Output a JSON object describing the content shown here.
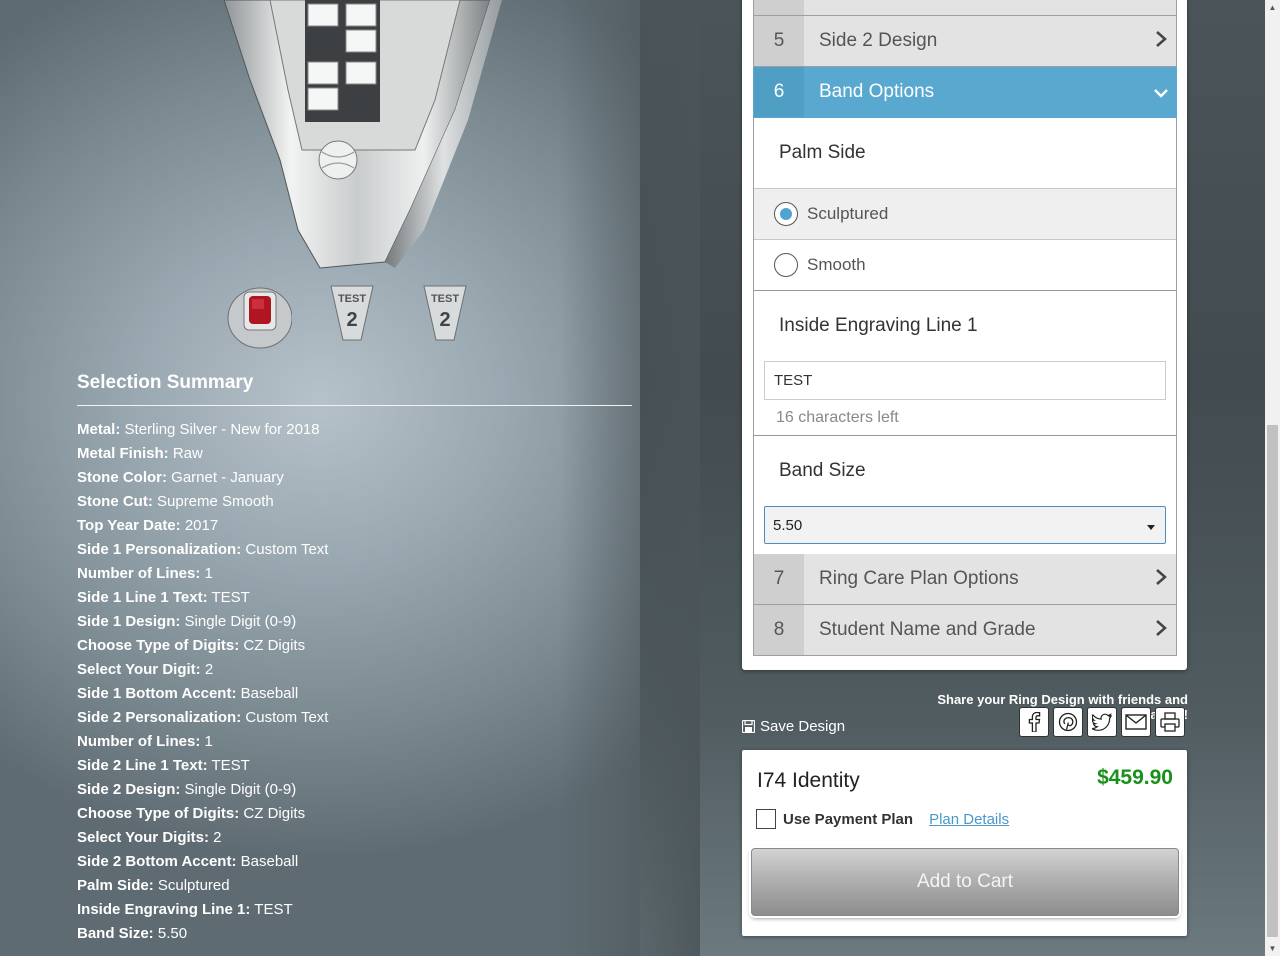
{
  "summary": {
    "title": "Selection Summary",
    "items": [
      {
        "k": "Metal:",
        "v": "Sterling Silver - New for 2018"
      },
      {
        "k": "Metal Finish:",
        "v": "Raw"
      },
      {
        "k": "Stone Color:",
        "v": "Garnet - January"
      },
      {
        "k": "Stone Cut:",
        "v": "Supreme Smooth"
      },
      {
        "k": "Top Year Date:",
        "v": "2017"
      },
      {
        "k": "Side 1 Personalization:",
        "v": "Custom Text"
      },
      {
        "k": "Number of Lines:",
        "v": "1"
      },
      {
        "k": "Side 1 Line 1 Text:",
        "v": "TEST"
      },
      {
        "k": "Side 1 Design:",
        "v": "Single Digit (0-9)"
      },
      {
        "k": "Choose Type of Digits:",
        "v": "CZ Digits"
      },
      {
        "k": "Select Your Digit:",
        "v": "2"
      },
      {
        "k": "Side 1 Bottom Accent:",
        "v": "Baseball"
      },
      {
        "k": "Side 2 Personalization:",
        "v": "Custom Text"
      },
      {
        "k": "Number of Lines:",
        "v": "1"
      },
      {
        "k": "Side 2 Line 1 Text:",
        "v": "TEST"
      },
      {
        "k": "Side 2 Design:",
        "v": "Single Digit (0-9)"
      },
      {
        "k": "Choose Type of Digits:",
        "v": "CZ Digits"
      },
      {
        "k": "Select Your Digits:",
        "v": "2"
      },
      {
        "k": "Side 2 Bottom Accent:",
        "v": "Baseball"
      },
      {
        "k": "Palm Side:",
        "v": "Sculptured"
      },
      {
        "k": "Inside Engraving Line 1:",
        "v": "TEST"
      },
      {
        "k": "Band Size:",
        "v": "5.50"
      }
    ]
  },
  "thumbs": {
    "side_text_1": "TEST",
    "side_text_2": "TEST"
  },
  "steps": {
    "step5": {
      "num": "5",
      "label": "Side 2 Design"
    },
    "step6": {
      "num": "6",
      "label": "Band Options"
    },
    "step7": {
      "num": "7",
      "label": "Ring Care Plan Options"
    },
    "step8": {
      "num": "8",
      "label": "Student Name and Grade"
    }
  },
  "band_options": {
    "palm_side_heading": "Palm Side",
    "palm_options": [
      {
        "label": "Sculptured",
        "selected": true
      },
      {
        "label": "Smooth",
        "selected": false
      }
    ],
    "engraving_heading": "Inside Engraving Line 1",
    "engraving_value": "TEST",
    "engraving_remaining": "16 characters left",
    "band_size_heading": "Band Size",
    "band_size_value": "5.50"
  },
  "share": {
    "text": "Share your Ring Design with friends and family!",
    "buttons": [
      "facebook",
      "pinterest",
      "twitter",
      "email",
      "print"
    ]
  },
  "save_design": "Save Design",
  "cart": {
    "product_name": "I74 Identity",
    "price": "$459.90",
    "payment_plan_label": "Use Payment Plan",
    "plan_details_link": "Plan Details",
    "add_to_cart": "Add to Cart"
  },
  "colors": {
    "accent": "#58a8cf",
    "price": "#199119",
    "link": "#4b97c9"
  }
}
